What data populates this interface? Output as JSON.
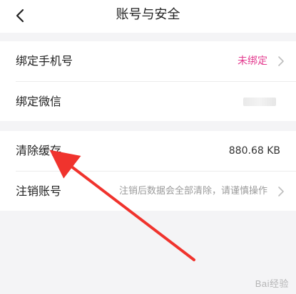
{
  "header": {
    "title": "账号与安全",
    "back_icon": "chevron-left-icon"
  },
  "rows": {
    "bind_phone": {
      "label": "绑定手机号",
      "value": "未绑定"
    },
    "bind_wechat": {
      "label": "绑定微信"
    },
    "clear_cache": {
      "label": "清除缓存",
      "value": "880.68 KB"
    },
    "delete_account": {
      "label": "注销账号",
      "value": "注销后数据会全部清除，请谨慎操作"
    }
  },
  "colors": {
    "accent_pink": "#e33a8e",
    "annotation_red": "#f0332d",
    "background": "#f4f4f6"
  },
  "watermark": "Bai经验"
}
